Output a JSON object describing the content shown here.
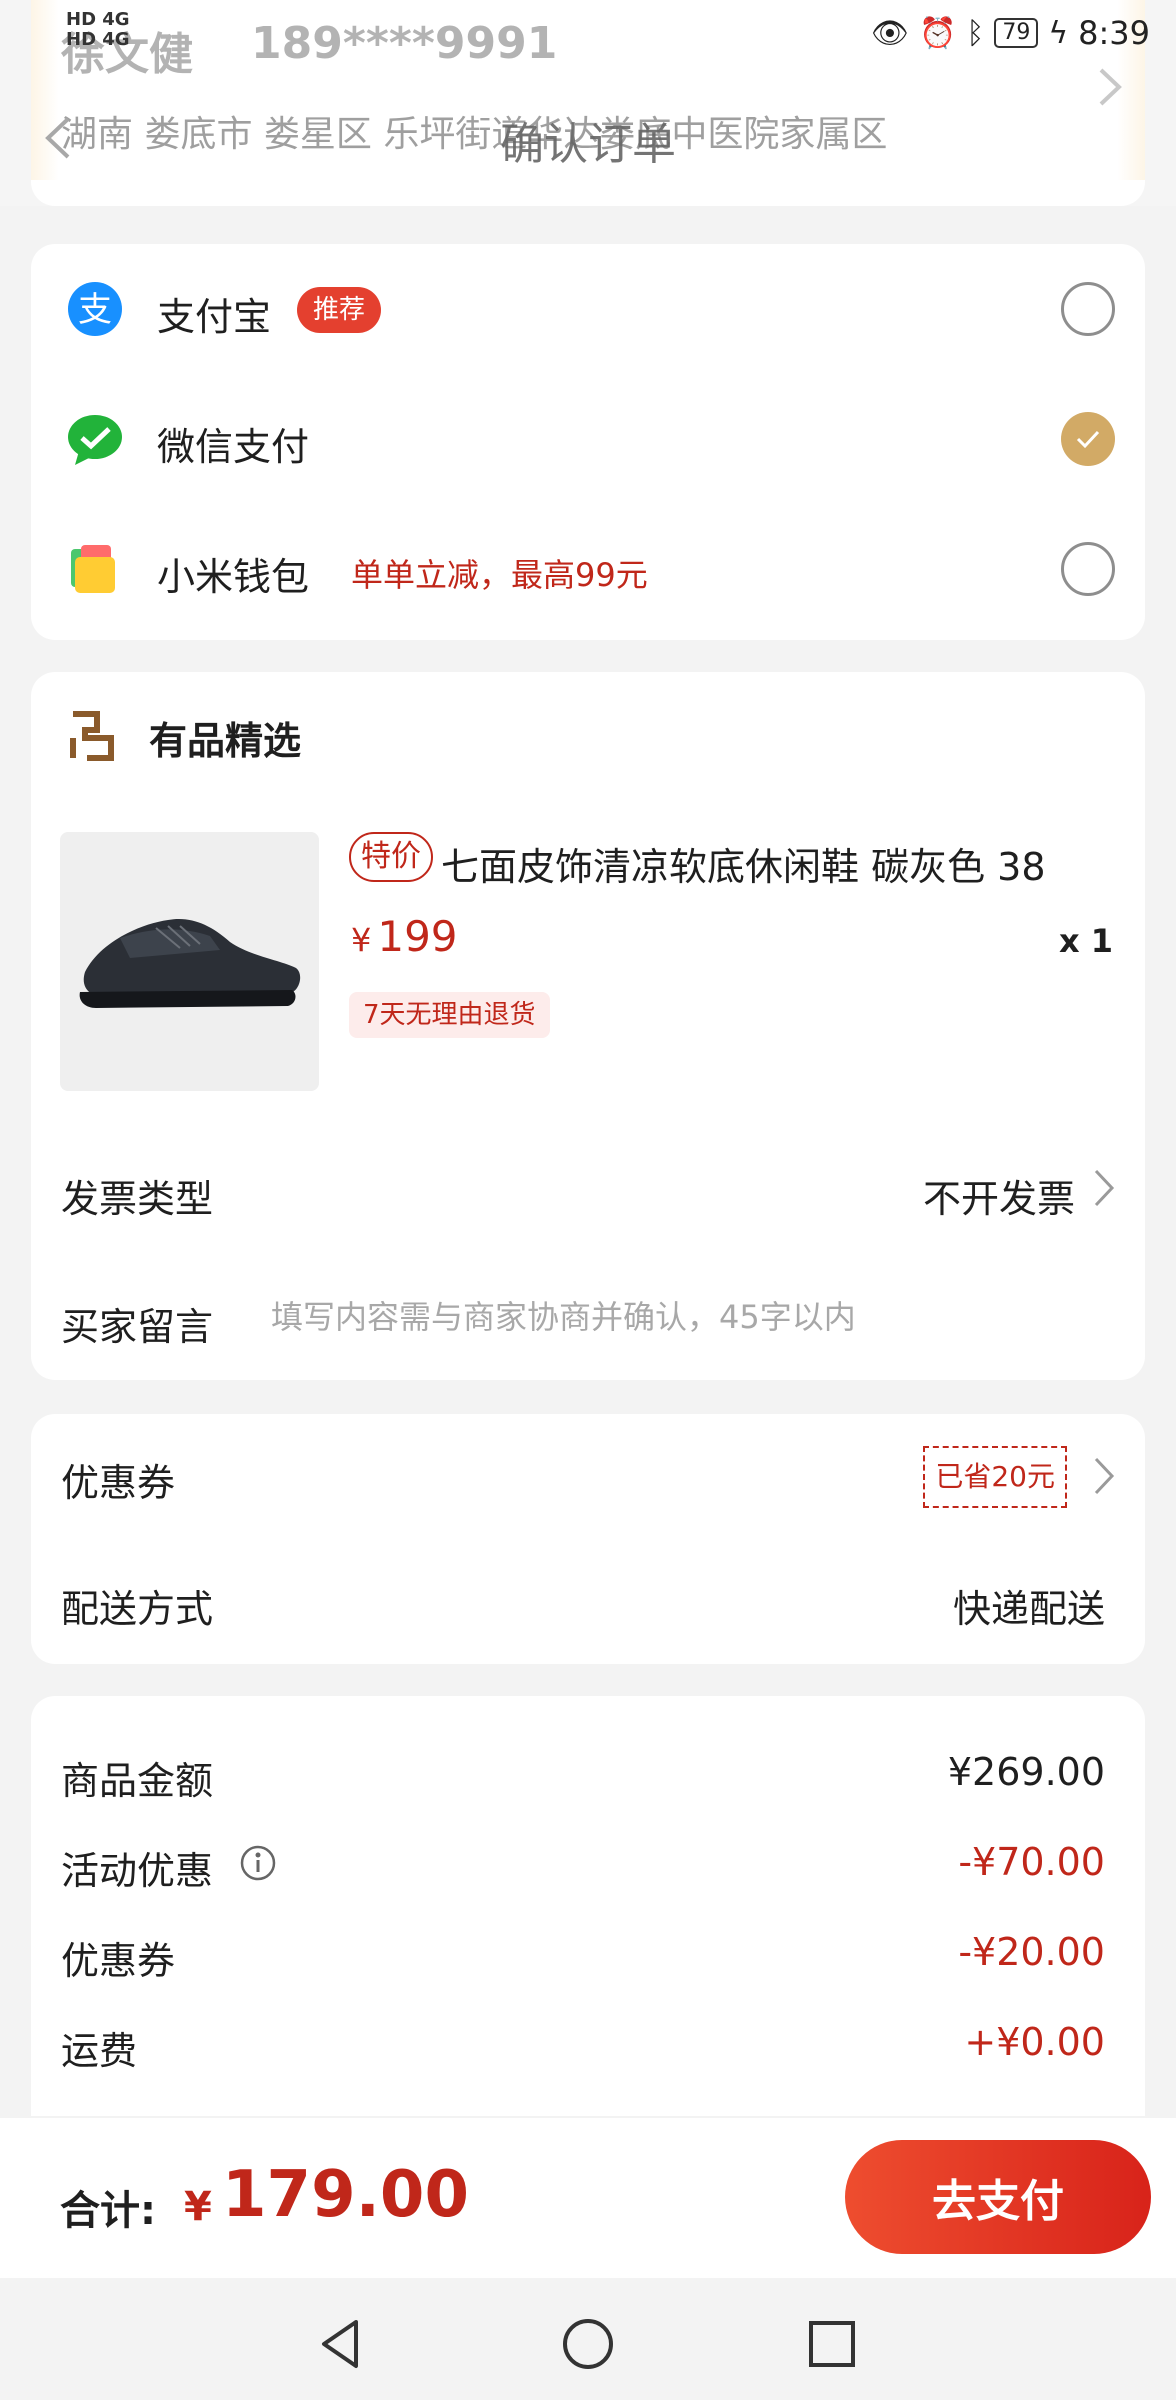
{
  "address": {
    "name": "徐文健",
    "phone": "189****9991",
    "detail": "湖南 娄底市 娄星区 乐坪街道华达娄底中医院家属区"
  },
  "status_bar": {
    "network_left": "HD 4G",
    "network_left2": "HD 4G",
    "battery": "79",
    "time": "8:39",
    "icons": [
      "eye-icon",
      "alarm-icon",
      "bluetooth-icon",
      "battery-icon",
      "charging-icon"
    ]
  },
  "nav": {
    "title": "确认订单"
  },
  "payment": {
    "methods": [
      {
        "label": "支付宝",
        "badge": "推荐",
        "icon": "alipay-icon",
        "selected": false
      },
      {
        "label": "微信支付",
        "icon": "wechat-pay-icon",
        "selected": true
      },
      {
        "label": "小米钱包",
        "promo": "单单立减，最高99元",
        "icon": "mi-wallet-icon",
        "selected": false
      }
    ]
  },
  "shop": {
    "name": "有品精选",
    "product": {
      "tag": "特价",
      "title": "七面皮饰清凉软底休闲鞋 碳灰色 38",
      "currency": "¥",
      "price": "199",
      "qty": "x 1",
      "return_policy": "7天无理由退货"
    },
    "invoice": {
      "label": "发票类型",
      "value": "不开发票"
    },
    "message": {
      "label": "买家留言",
      "placeholder": "填写内容需与商家协商并确认，45字以内"
    }
  },
  "delivery": {
    "coupon": {
      "label": "优惠券",
      "saved": "已省20元"
    },
    "shipping": {
      "label": "配送方式",
      "value": "快递配送"
    }
  },
  "summary": {
    "rows": [
      {
        "label": "商品金额",
        "value": "¥269.00"
      },
      {
        "label": "活动优惠",
        "value": "-¥70.00"
      },
      {
        "label": "优惠券",
        "value": "-¥20.00"
      },
      {
        "label": "运费",
        "value": "+¥0.00"
      }
    ]
  },
  "footer": {
    "total_label": "合计:",
    "currency": "¥",
    "total": "179.00",
    "pay_button": "去支付"
  },
  "colors": {
    "accent_red": "#c0271a",
    "gold": "#d2aa66",
    "button_red": "#e4402f"
  }
}
